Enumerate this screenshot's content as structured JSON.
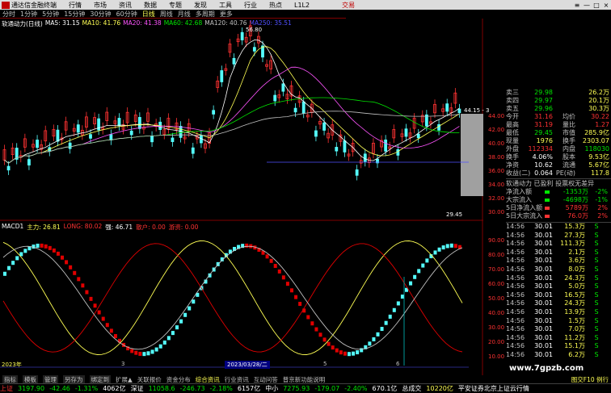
{
  "menubar": {
    "title": "通达信金融终端",
    "items": [
      "行情",
      "市场",
      "资讯",
      "数据",
      "专题",
      "发现",
      "工具",
      "行业",
      "热点",
      "L1L2"
    ],
    "trade": "交易",
    "win_buttons": [
      "≡",
      "—",
      "□",
      "×"
    ]
  },
  "periodbar": {
    "items": [
      "分时",
      "1分钟",
      "5分钟",
      "15分钟",
      "30分钟",
      "60分钟",
      "日线",
      "周线",
      "月线",
      "多周期",
      "更多"
    ],
    "active": "日线"
  },
  "ma_legend": {
    "name": "软通动力(日线)",
    "ma5": "MA5: 31.15",
    "ma10": "MA10: 41.76",
    "ma20": "MA20: 41.38",
    "ma60": "MA60: 42.68",
    "ma120": "MA120: 40.76",
    "ma250": "MA250: 35.51"
  },
  "price_annotations": {
    "high": "56.80",
    "last": "44.15 - 3",
    "low": "29.45"
  },
  "price_scale": [
    "44.00",
    "42.00",
    "40.00",
    "38.00",
    "36.00",
    "34.00",
    "32.00",
    "30.00"
  ],
  "macd_legend": {
    "name": "MACD1",
    "a": "主力: 26.81",
    "b": "LONG: 80.02",
    "c": "强: 46.71",
    "d": "散户: 0.00",
    "e": "游资: 0.00"
  },
  "macd_scale": [
    "90.00",
    "80.00",
    "70.00",
    "60.00",
    "50.00",
    "40.00",
    "30.00",
    "20.00",
    "10.00"
  ],
  "date_bar": {
    "year": "2023年",
    "selected": "2023/03/28/二",
    "marks": [
      "3",
      "4",
      "5",
      "6"
    ]
  },
  "quote": {
    "rows": [
      {
        "k": "卖三",
        "v": "29.98",
        "a": "",
        "b": "26.2万"
      },
      {
        "k": "卖四",
        "v": "29.97",
        "a": "",
        "b": "20.1万"
      },
      {
        "k": "卖五",
        "v": "29.96",
        "a": "",
        "b": "30.3万"
      },
      {
        "k": "今开",
        "v": "31.16",
        "a": "均价",
        "b": "30.22"
      },
      {
        "k": "最高",
        "v": "31.19",
        "a": "量比",
        "b": "1.27"
      },
      {
        "k": "最低",
        "v": "29.45",
        "a": "市值",
        "b": "285.9亿"
      },
      {
        "k": "现量",
        "v": "1976",
        "a": "换手",
        "b": "2303.07"
      },
      {
        "k": "外盘",
        "v": "112334",
        "a": "内盘",
        "b": "118030"
      },
      {
        "k": "换手",
        "v": "4.06%",
        "a": "股本",
        "b": "9.53亿"
      },
      {
        "k": "净资",
        "v": "10.62",
        "a": "流通",
        "b": "5.67亿"
      },
      {
        "k": "收益(二)",
        "v": "0.064",
        "a": "PE(动)",
        "b": "117.8"
      }
    ],
    "section_title": "软通动力 已盈利 投票权无差异",
    "flows": [
      {
        "k": "净流入额",
        "v": "-1353万",
        "p": "-2%"
      },
      {
        "k": "大宗流入",
        "v": "-4698万",
        "p": "-1%"
      },
      {
        "k": "5日净流入额",
        "v": "5789万",
        "p": "2%"
      },
      {
        "k": "5日大宗流入",
        "v": "76.0万",
        "p": "2%"
      }
    ],
    "ticks": [
      {
        "t": "14:56",
        "p": "30.01",
        "v": "15.3万",
        "d": "S"
      },
      {
        "t": "14:56",
        "p": "30.01",
        "v": "27.3万",
        "d": "S"
      },
      {
        "t": "14:56",
        "p": "30.01",
        "v": "111.3万",
        "d": "S"
      },
      {
        "t": "14:56",
        "p": "30.01",
        "v": "2.1万",
        "d": "S"
      },
      {
        "t": "14:56",
        "p": "30.01",
        "v": "3.6万",
        "d": "S"
      },
      {
        "t": "14:56",
        "p": "30.01",
        "v": "8.0万",
        "d": "S"
      },
      {
        "t": "14:56",
        "p": "30.01",
        "v": "24.3万",
        "d": "S"
      },
      {
        "t": "14:56",
        "p": "30.01",
        "v": "5.0万",
        "d": "S"
      },
      {
        "t": "14:56",
        "p": "30.01",
        "v": "16.5万",
        "d": "S"
      },
      {
        "t": "14:56",
        "p": "30.01",
        "v": "24.3万",
        "d": "S"
      },
      {
        "t": "14:56",
        "p": "30.01",
        "v": "13.9万",
        "d": "S"
      },
      {
        "t": "14:56",
        "p": "30.01",
        "v": "1.5万",
        "d": "S"
      },
      {
        "t": "14:56",
        "p": "30.01",
        "v": "7.0万",
        "d": "S"
      },
      {
        "t": "14:56",
        "p": "30.01",
        "v": "11.2万",
        "d": "S"
      },
      {
        "t": "14:56",
        "p": "30.01",
        "v": "15.1万",
        "d": "S"
      },
      {
        "t": "14:56",
        "p": "30.01",
        "v": "6.2万",
        "d": "S"
      }
    ]
  },
  "funcbar": {
    "items": [
      "指标",
      "模板",
      "管理",
      "另存为",
      "绑定到",
      "扩展▲",
      "关联报价",
      "资金分布",
      "综合资讯",
      "行业资讯",
      "互动问答",
      "普京新功能说明"
    ],
    "right": "图交F10 例行"
  },
  "indexbar": {
    "sh": {
      "name": "上证",
      "v": "3197.90",
      "d": "-42.46",
      "p": "-1.31%",
      "amt": "4062亿"
    },
    "sz": {
      "name": "深证",
      "v": "11058.6",
      "d": "-246.73",
      "p": "-2.18%",
      "amt": "6157亿"
    },
    "zx": {
      "name": "中小",
      "v": "7275.93",
      "d": "-179.07",
      "p": "-2.40%",
      "amt": "670.1亿"
    },
    "total": {
      "name": "总成交",
      "amt": "10220亿"
    },
    "ticker": "平安证券北京上证云行情"
  },
  "watermark": "www.7gpzb.com",
  "colors": {
    "up": "#ff3232",
    "down": "#54ffff",
    "ma5": "#ffffff",
    "ma10": "#ffff54",
    "ma20": "#ff54ff",
    "ma60": "#00e600",
    "ma120": "#c0c0c0",
    "ma250": "#5050ff"
  }
}
